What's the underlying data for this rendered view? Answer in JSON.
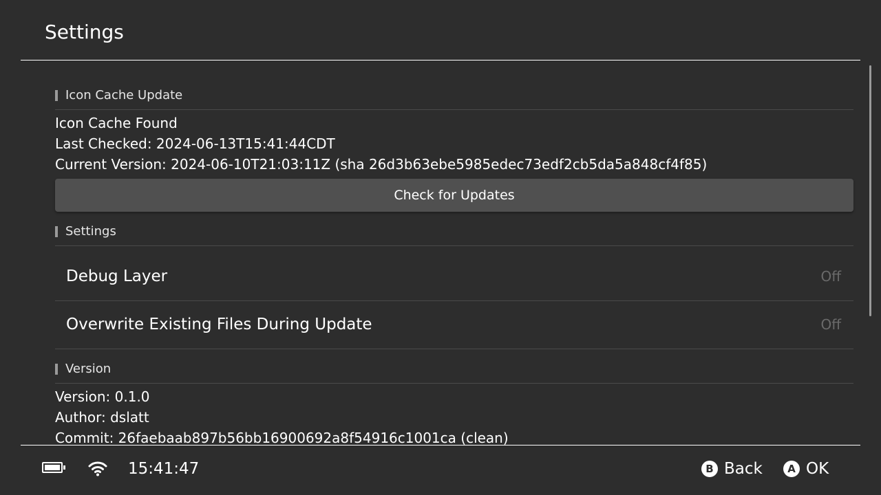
{
  "header": {
    "title": "Settings"
  },
  "icon_cache": {
    "section_title": "Icon Cache Update",
    "status": "Icon Cache Found",
    "last_checked": "Last Checked: 2024-06-13T15:41:44CDT",
    "current_version": "Current Version: 2024-06-10T21:03:11Z (sha 26d3b63ebe5985edec73edf2cb5da5a848cf4f85)",
    "check_button_label": "Check for Updates"
  },
  "settings": {
    "section_title": "Settings",
    "items": [
      {
        "label": "Debug Layer",
        "value": "Off"
      },
      {
        "label": "Overwrite Existing Files During Update",
        "value": "Off"
      }
    ]
  },
  "version": {
    "section_title": "Version",
    "version": "Version: 0.1.0",
    "author": "Author: dslatt",
    "commit": "Commit: 26faebaab897b56bb16900692a8f54916c1001ca (clean)"
  },
  "footer": {
    "battery_icon": "battery-icon",
    "wifi_icon": "wifi-icon",
    "time": "15:41:47",
    "actions": [
      {
        "glyph": "B",
        "label": "Back"
      },
      {
        "glyph": "A",
        "label": "OK"
      }
    ]
  },
  "colors": {
    "background": "#2d2d2d",
    "button": "#505050",
    "divider": "#ffffff",
    "muted_value": "#6a6a6a"
  }
}
